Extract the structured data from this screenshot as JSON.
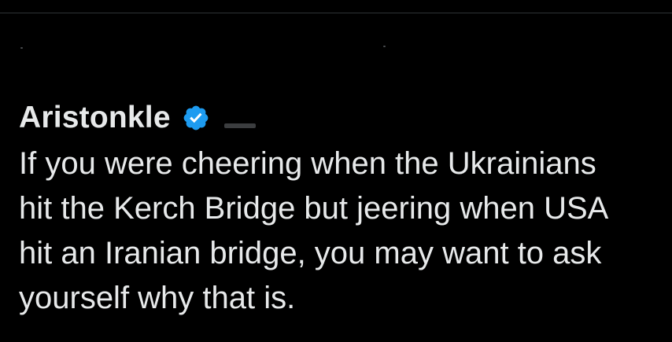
{
  "post": {
    "author_name": "Aristonkle",
    "verified_icon": "verified-badge-icon",
    "lines": [
      "If you were cheering when the Ukrainians",
      "hit the Kerch Bridge but jeering when USA",
      "hit an Iranian bridge, you may want to ask",
      "yourself why that is."
    ]
  },
  "colors": {
    "background": "#000000",
    "text": "#e7e9ea",
    "verified_blue": "#1d9bf0",
    "divider": "#2f3336"
  }
}
